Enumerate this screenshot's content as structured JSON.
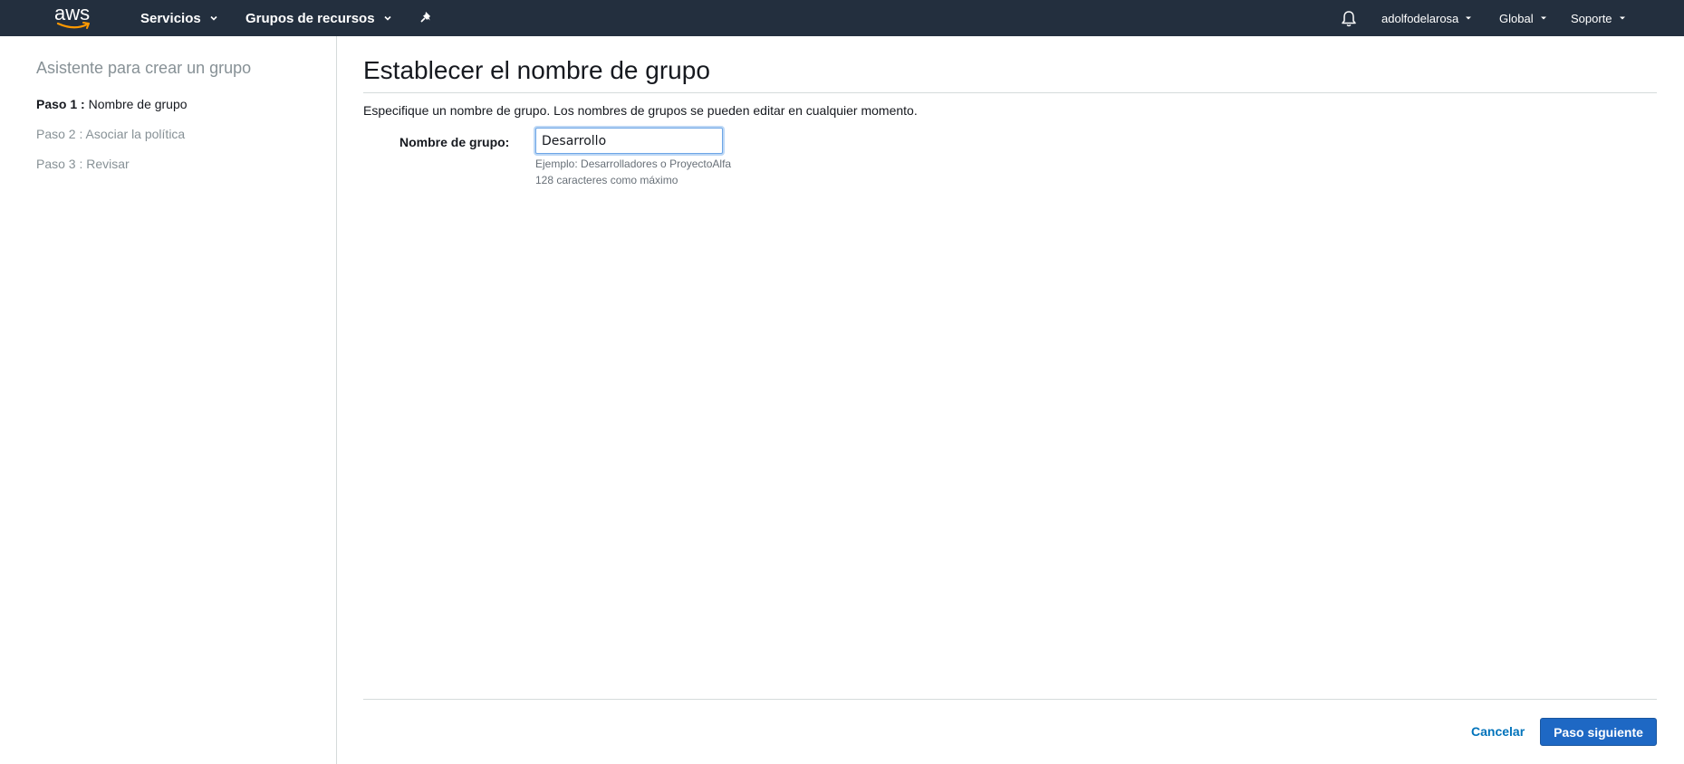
{
  "topnav": {
    "logo_text": "aws",
    "services_label": "Servicios",
    "resource_groups_label": "Grupos de recursos",
    "username": "adolfodelarosa",
    "region": "Global",
    "support": "Soporte",
    "background_color": "#232f3e"
  },
  "sidebar": {
    "title": "Asistente para crear un grupo",
    "steps": [
      {
        "number": "Paso 1 :",
        "label": "Nombre de grupo",
        "active": true
      },
      {
        "number": "Paso 2 :",
        "label": "Asociar la política",
        "active": false
      },
      {
        "number": "Paso 3 :",
        "label": "Revisar",
        "active": false
      }
    ]
  },
  "main": {
    "title": "Establecer el nombre de grupo",
    "description": "Especifique un nombre de grupo. Los nombres de grupos se pueden editar en cualquier momento.",
    "field": {
      "label": "Nombre de grupo:",
      "value": "Desarrollo",
      "help_example": "Ejemplo: Desarrolladores o ProyectoAlfa",
      "help_limit": "128 caracteres como máximo"
    },
    "cancel_label": "Cancelar",
    "next_label": "Paso siguiente",
    "primary_color": "#1e68c4",
    "link_color": "#0073bb"
  }
}
